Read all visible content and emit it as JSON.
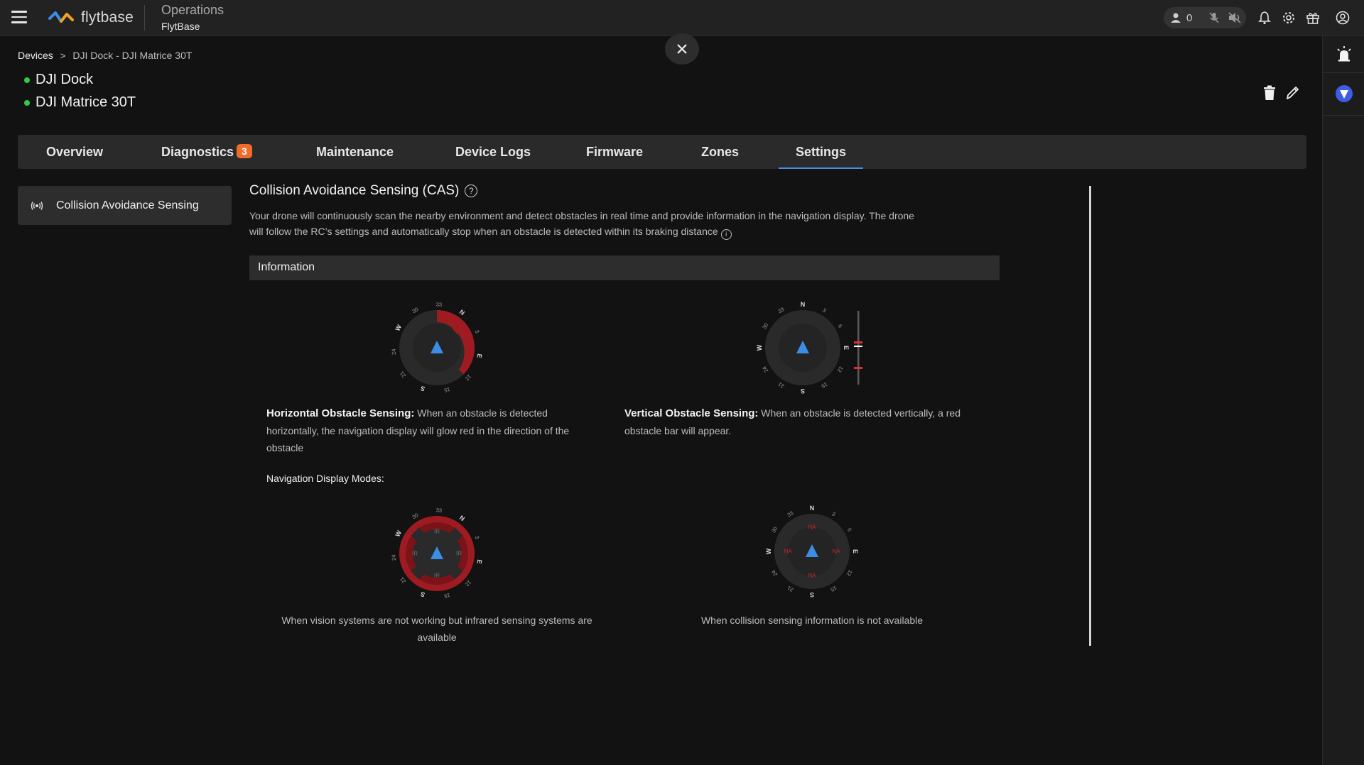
{
  "header": {
    "logo_text": "flytbase",
    "app_title": "Operations",
    "org_name": "FlytBase",
    "user_count": "0"
  },
  "breadcrumb": {
    "root": "Devices",
    "separator": ">",
    "current": "DJI Dock - DJI Matrice 30T"
  },
  "devices": [
    {
      "name": "DJI Dock",
      "status_color": "#2ecc40"
    },
    {
      "name": "DJI Matrice 30T",
      "status_color": "#2ecc40"
    }
  ],
  "tabs": [
    {
      "label": "Overview"
    },
    {
      "label": "Diagnostics",
      "badge": "3"
    },
    {
      "label": "Maintenance"
    },
    {
      "label": "Device Logs"
    },
    {
      "label": "Firmware"
    },
    {
      "label": "Zones"
    },
    {
      "label": "Settings",
      "active": true
    }
  ],
  "sidebar": {
    "items": [
      {
        "label": "Collision Avoidance Sensing",
        "icon": "broadcast-icon"
      }
    ]
  },
  "cas": {
    "title": "Collision Avoidance Sensing (CAS)",
    "help_glyph": "?",
    "description": "Your drone will continuously scan the nearby environment and detect obstacles in real time and provide information in the navigation display. The drone will follow the RC’s settings and automatically stop when an obstacle is detected within its braking distance",
    "info_glyph": "i",
    "section_header": "Information",
    "horizontal": {
      "title": "Horizontal Obstacle Sensing:",
      "text": " When an obstacle is detected horizontally, the navigation display will glow red in the direction of the obstacle"
    },
    "vertical": {
      "title": "Vertical Obstacle Sensing:",
      "text": " When an obstacle is detected vertically, a red obstacle bar will appear."
    },
    "nav_modes_label": "Navigation Display Modes:",
    "mode_ir_caption": "When vision systems are not working but infrared sensing systems are available",
    "mode_na_caption": "When collision sensing information is not available",
    "gauge_labels": {
      "rotated": [
        "30",
        "33",
        "N",
        "3",
        "E",
        "12",
        "15",
        "S",
        "21",
        "24",
        "W"
      ],
      "north_up": [
        "N",
        "3",
        "6",
        "E",
        "12",
        "15",
        "S",
        "21",
        "24",
        "W",
        "30",
        "33"
      ],
      "ir": "IR",
      "na": "NA"
    }
  },
  "colors": {
    "accent": "#4a90e2",
    "danger": "#9e1b22",
    "badge": "#f06a2a",
    "status_ok": "#2ecc40"
  }
}
